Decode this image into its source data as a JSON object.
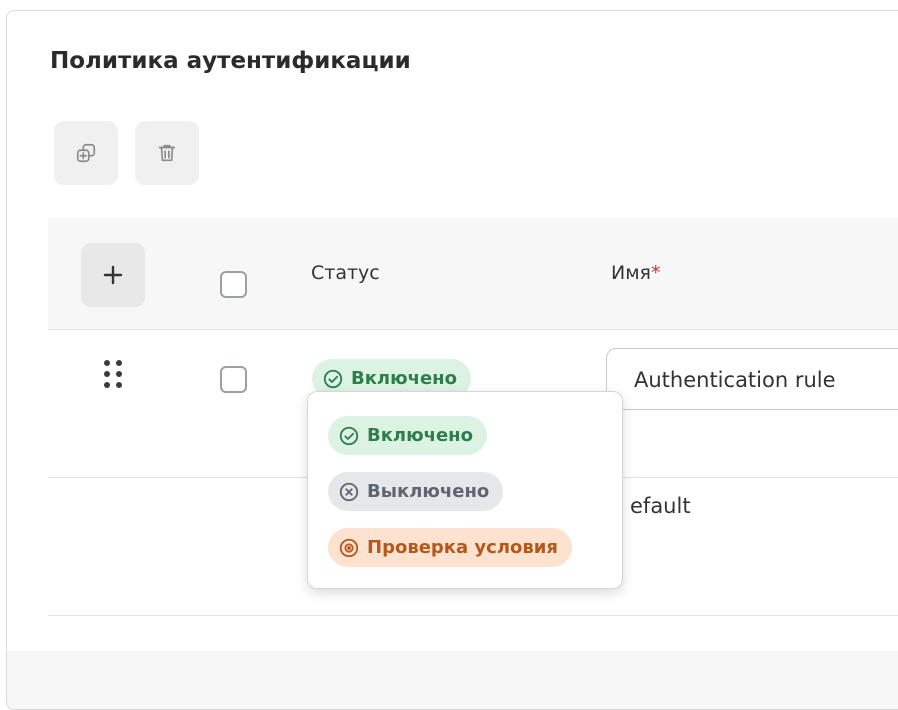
{
  "page": {
    "title": "Политика аутентификации"
  },
  "toolbar": {
    "duplicate_icon": "copy-add-icon",
    "delete_icon": "trash-icon"
  },
  "table": {
    "add_label": "+",
    "columns": {
      "status": "Статус",
      "name": "Имя",
      "name_required_mark": "*"
    },
    "rows": [
      {
        "status": "Включено",
        "name_value": "Authentication rule"
      },
      {
        "name_value": "efault"
      }
    ]
  },
  "status_dropdown": {
    "options": [
      {
        "label": "Включено",
        "icon": "check-circle-icon"
      },
      {
        "label": "Выключено",
        "icon": "x-circle-icon"
      },
      {
        "label": "Проверка условия",
        "icon": "eye-icon"
      }
    ]
  },
  "colors": {
    "enabled_bg": "#dcf3e3",
    "enabled_fg": "#2e7d4a",
    "disabled_bg": "#e6e7ea",
    "disabled_fg": "#5f6570",
    "check_bg": "#fde3cf",
    "check_fg": "#b5581d"
  }
}
